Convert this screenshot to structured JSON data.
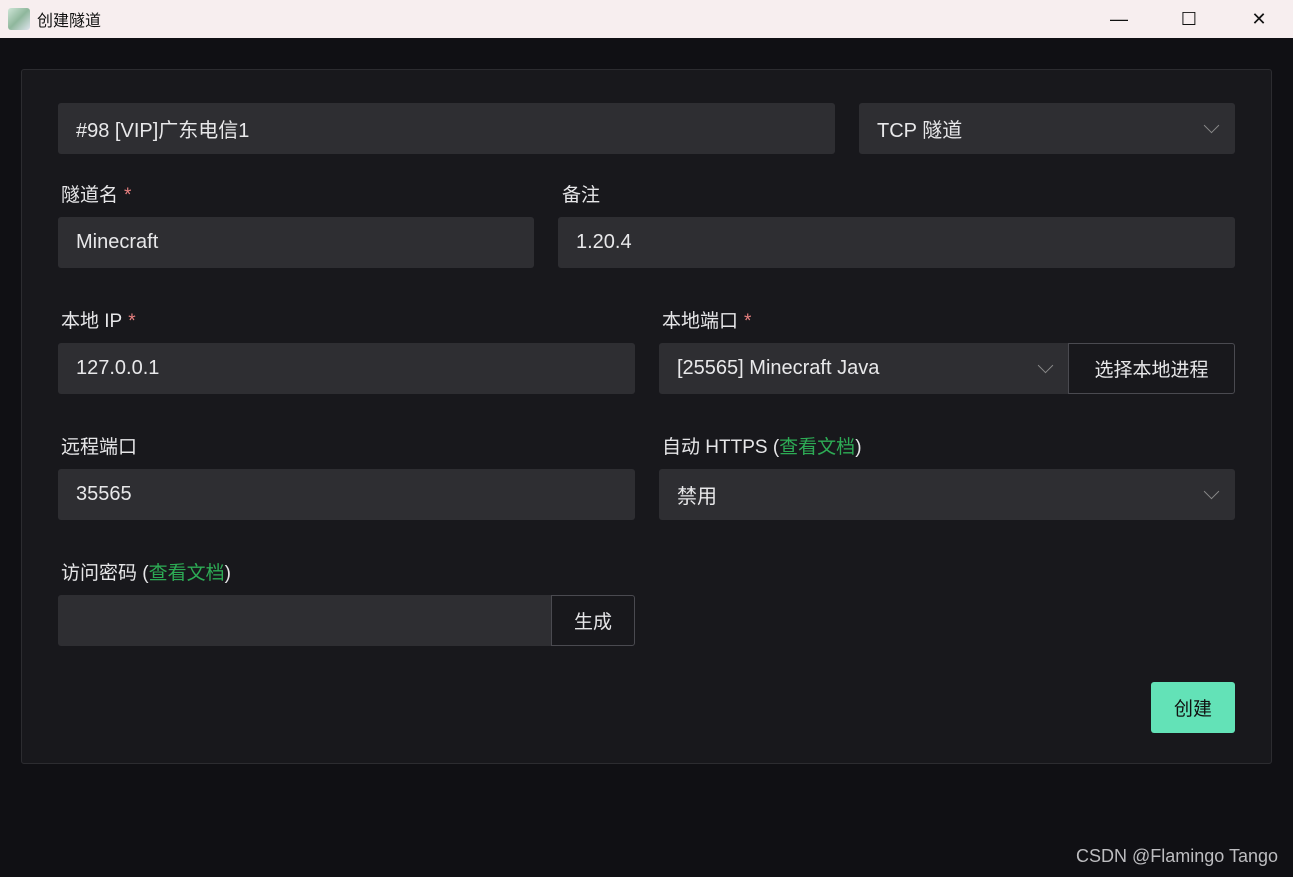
{
  "window": {
    "title": "创建隧道",
    "minimize": "—",
    "maximize": "☐",
    "close": "✕"
  },
  "form": {
    "server": "#98 [VIP]广东电信1",
    "tunnel_type": "TCP 隧道",
    "name_label": "隧道名",
    "name_value": "Minecraft",
    "note_label": "备注",
    "note_value": "1.20.4",
    "local_ip_label": "本地 IP",
    "local_ip_value": "127.0.0.1",
    "local_port_label": "本地端口",
    "local_port_value": "[25565] Minecraft Java",
    "select_process": "选择本地进程",
    "remote_port_label": "远程端口",
    "remote_port_value": "35565",
    "auto_https_label": "自动 HTTPS",
    "auto_https_value": "禁用",
    "password_label": "访问密码",
    "password_value": "",
    "view_docs": "查看文档",
    "generate": "生成",
    "required": "*",
    "open_paren": "(",
    "close_paren": ")",
    "create": "创建"
  },
  "watermark": "CSDN @Flamingo Tango"
}
